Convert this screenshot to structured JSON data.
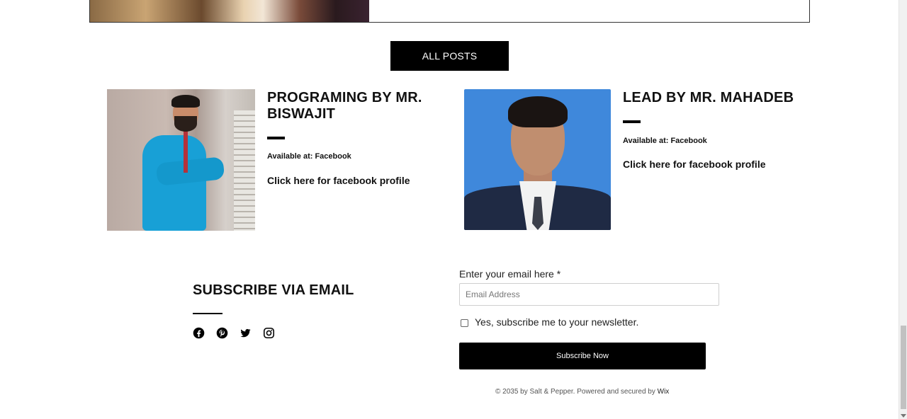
{
  "nav": {
    "all_posts_label": "ALL POSTS"
  },
  "authors": [
    {
      "title": "PROGRAMING BY MR. BISWAJIT",
      "available": "Available at: Facebook",
      "link_label": "Click here for facebook profile"
    },
    {
      "title": "LEAD BY MR. MAHADEB",
      "available": "Available at: Facebook",
      "link_label": "Click here for facebook profile"
    }
  ],
  "subscribe": {
    "title": "SUBSCRIBE VIA EMAIL",
    "socials": [
      "facebook-icon",
      "pinterest-icon",
      "twitter-icon",
      "instagram-icon"
    ],
    "email_label": "Enter your email here *",
    "email_placeholder": "Email Address",
    "email_value": "",
    "newsletter_checkbox_label": "Yes, subscribe me to your newsletter.",
    "newsletter_checked": false,
    "button_label": "Subscribe Now"
  },
  "footer": {
    "text": "© 2035 by Salt & Pepper. Powered and secured by ",
    "link": "Wix"
  },
  "colors": {
    "accent": "#000000",
    "photo2_bg": "#3f88db"
  }
}
